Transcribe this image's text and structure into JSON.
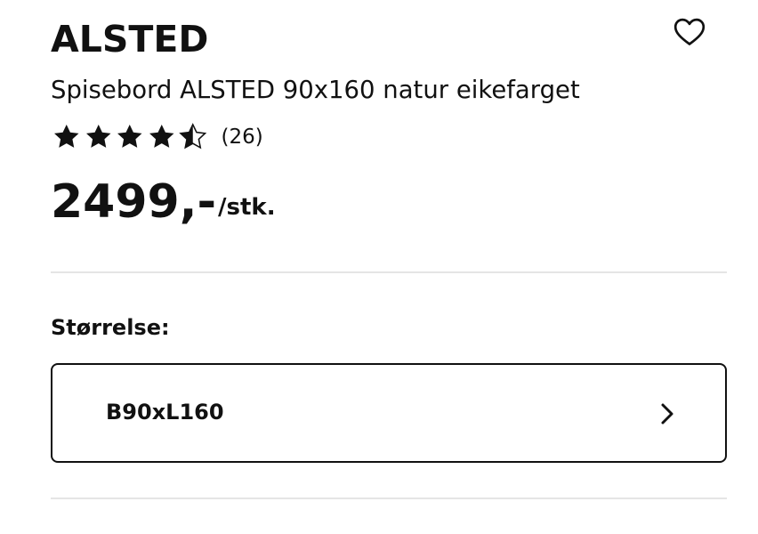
{
  "product": {
    "name": "ALSTED",
    "description": "Spisebord ALSTED 90x160 natur eikefarget",
    "favorite_icon": "heart-icon",
    "rating": {
      "value": 4.5,
      "max": 5,
      "count_text": "(26)",
      "star_icons": [
        "star-filled-icon",
        "star-filled-icon",
        "star-filled-icon",
        "star-filled-icon",
        "star-half-icon"
      ]
    },
    "price": {
      "amount": "2499,-",
      "unit": "/stk."
    }
  },
  "size": {
    "label": "Størrelse:",
    "selected_value": "B90xL160",
    "chevron_icon": "chevron-right-icon"
  },
  "colors": {
    "text": "#111111",
    "divider": "#e5e5e5",
    "background": "#ffffff"
  }
}
